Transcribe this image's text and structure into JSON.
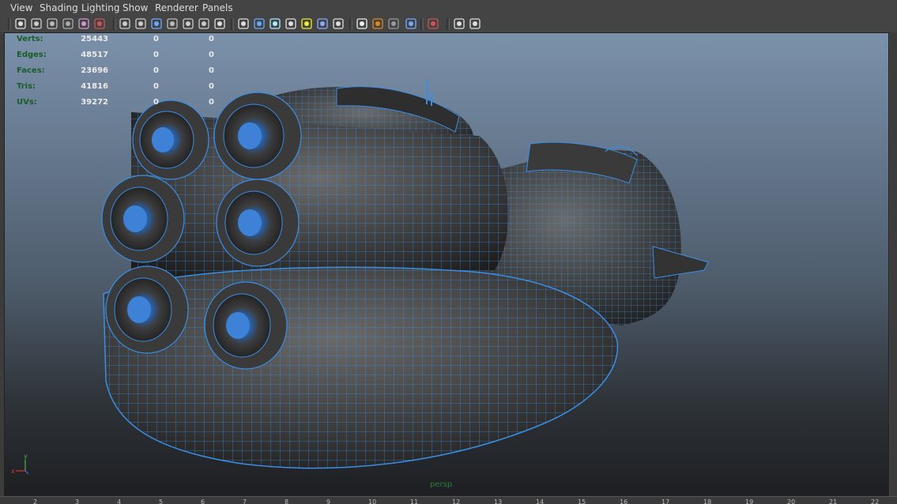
{
  "menu": [
    {
      "label": "View"
    },
    {
      "label": "Shading"
    },
    {
      "label": "Lighting"
    },
    {
      "label": "Show"
    },
    {
      "label": "Renderer"
    },
    {
      "label": "Panels"
    }
  ],
  "hud": {
    "rows": [
      {
        "label": "Verts:",
        "v1": "25443",
        "v2": "0",
        "v3": "0"
      },
      {
        "label": "Edges:",
        "v1": "48517",
        "v2": "0",
        "v3": "0"
      },
      {
        "label": "Faces:",
        "v1": "23696",
        "v2": "0",
        "v3": "0"
      },
      {
        "label": "Tris:",
        "v1": "41816",
        "v2": "0",
        "v3": "0"
      },
      {
        "label": "UVs:",
        "v1": "39272",
        "v2": "0",
        "v3": "0"
      }
    ]
  },
  "camera_label": "persp",
  "axis": {
    "x": "x",
    "y": "y"
  },
  "ruler": [
    "2",
    "3",
    "4",
    "5",
    "6",
    "7",
    "8",
    "9",
    "10",
    "11",
    "12",
    "13",
    "14",
    "15",
    "16",
    "17",
    "18",
    "19",
    "20",
    "21",
    "22"
  ],
  "toolbar_icons": [
    "camera-select-icon",
    "camera-attr-icon",
    "bookmark-icon",
    "image-plane-icon",
    "2d-pan-zoom-icon",
    "grease-pencil-icon",
    "grid-icon",
    "film-gate-icon",
    "resolution-gate-icon",
    "gate-mask-icon",
    "field-chart-icon",
    "safe-action-icon",
    "safe-title-icon",
    "wireframe-icon",
    "smooth-shade-icon",
    "wireframe-on-shaded-icon",
    "textured-icon",
    "use-lights-icon",
    "shadows-icon",
    "ambient-occlusion-icon",
    "motion-blur-icon",
    "depth-of-field-icon",
    "anti-alias-icon",
    "xray-icon",
    "xray-joints-icon",
    "isolate-select-icon",
    "hud-toggle-icon"
  ],
  "colors": {
    "wire": "#3a8ee6",
    "viewport_top": "#7b91aa",
    "viewport_bottom": "#1d1f22",
    "hud_label": "#1a5c2a"
  }
}
